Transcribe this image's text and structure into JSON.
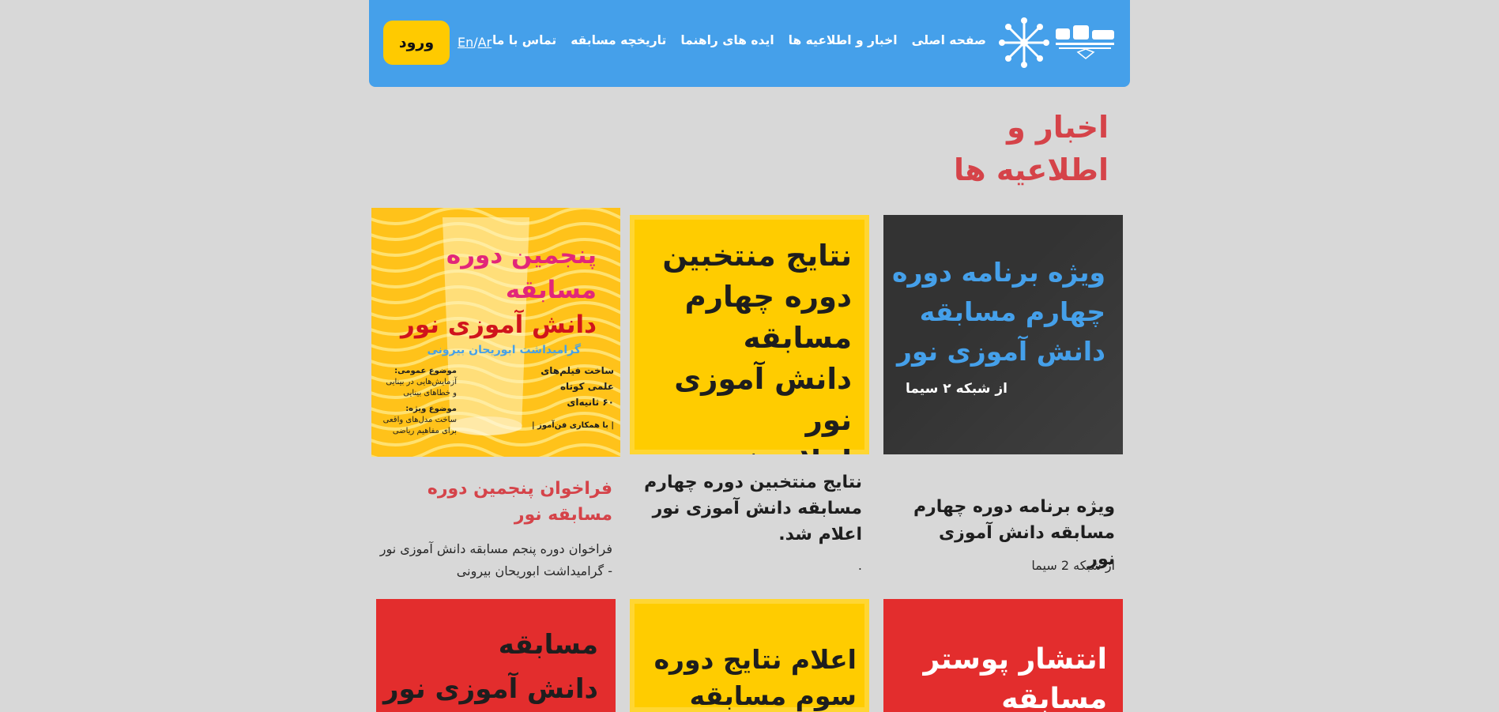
{
  "nav": {
    "items": [
      {
        "label": "صفحه اصلی"
      },
      {
        "label": "اخبار و اطلاعیه ها"
      },
      {
        "label": "ایده های راهنما"
      },
      {
        "label": "تاریخچه مسابقه"
      },
      {
        "label": "تماس با ما"
      }
    ],
    "lang_en": "En",
    "lang_sep": "/",
    "lang_ar": "Ar",
    "login_label": "ورود"
  },
  "page": {
    "title": "اخبار و اطلاعیه ها"
  },
  "cards": [
    {
      "poster_lines": [
        "ویژه برنامه دوره",
        "چهارم مسابقه",
        "دانش آموزی نور"
      ],
      "poster_sub": "از شبکه ۲ سیما",
      "title": "ویژه برنامه دوره چهارم مسابقه دانش آموزی نور",
      "desc": "از شبکه 2 سیما"
    },
    {
      "poster_lines": [
        "نتایج منتخبین",
        "دوره چهارم",
        "مسابقه",
        "دانش آموزی نور",
        "اعلام شد."
      ],
      "title": "نتایج منتخبین دوره چهارم مسابقه دانش آموزی نور اعلام شد.",
      "desc": "."
    },
    {
      "poster_lines": [
        "پنجمین دوره",
        "مسابقه",
        "دانش آموزی نور"
      ],
      "poster_sub": "گرامیداشت ابوریحان بیرونی",
      "poster_side": [
        "ساخت فیلم‌های",
        "علمی کوتاه",
        "۶۰ ثانیه‌ای"
      ],
      "poster_side_note": "| با همکاری فن‌آموز |",
      "poster_topic1_title": "موضوع عمومی:",
      "poster_topic1_lines": [
        "آزمایش‌هایی در بینایی",
        "و خطاهای بینایی"
      ],
      "poster_topic2_title": "موضوع ویژه:",
      "poster_topic2_lines": [
        "ساخت مدل‌های واقعی",
        "برای مفاهیم ریاضی"
      ],
      "title": "فراخوان پنجمین دوره مسابقه نور",
      "desc": "فراخوان دوره پنجم مسابقه دانش آموزی نور - گرامیداشت ابوریحان بیرونی"
    }
  ],
  "row2": [
    {
      "poster_lines": [
        "انتشار پوستر",
        "مسابقه"
      ]
    },
    {
      "poster_lines": [
        "اعلام نتایج دوره",
        "سوم مسابقه"
      ]
    },
    {
      "poster_lines": [
        "مسابقه",
        "دانش آموزی نور"
      ]
    }
  ],
  "colors": {
    "header_bg": "#45a0ea",
    "accent_red": "#d54349",
    "login_bg": "#ffca00",
    "poster_yellow": "#ffcc00",
    "poster_dark": "#333333",
    "poster_red": "#e32d2d",
    "poster_blue_text": "#45a0ea"
  }
}
